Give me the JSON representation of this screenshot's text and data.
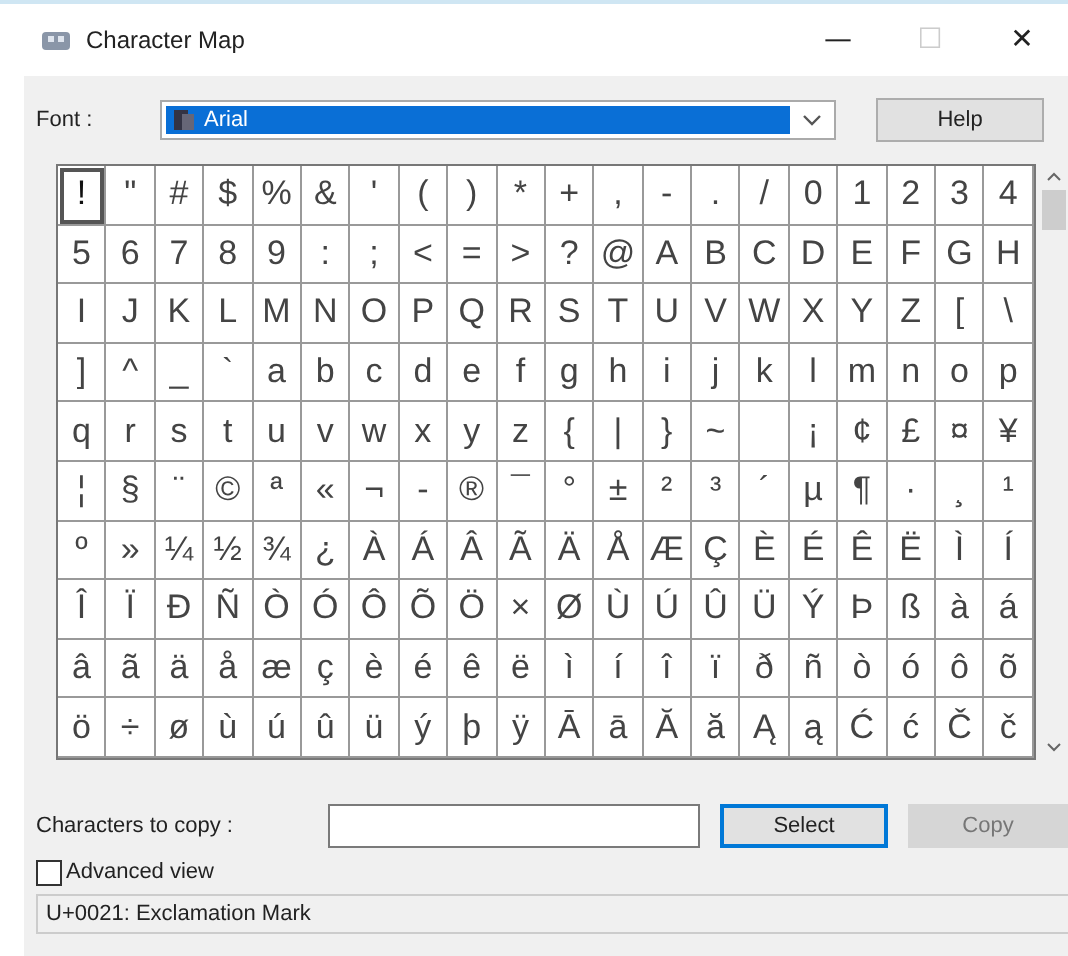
{
  "window": {
    "title": "Character Map",
    "controls": [
      "—",
      "☐",
      "✕"
    ]
  },
  "font": {
    "label": "Font :",
    "value": "Arial",
    "selected": true
  },
  "help_button": "Help",
  "grid": [
    [
      {
        "char": "!",
        "selected": true
      },
      {
        "char": "\"",
        "selected": false
      },
      {
        "char": "#",
        "selected": false
      },
      {
        "char": "$",
        "selected": false
      },
      {
        "char": "%",
        "selected": false
      },
      {
        "char": "&",
        "selected": false
      },
      {
        "char": "'",
        "selected": false
      },
      {
        "char": "(",
        "selected": false
      },
      {
        "char": ")",
        "selected": false
      },
      {
        "char": "*",
        "selected": false
      },
      {
        "char": "+",
        "selected": false
      },
      {
        "char": ",",
        "selected": false
      },
      {
        "char": "-",
        "selected": false
      },
      {
        "char": ".",
        "selected": false
      },
      {
        "char": "/",
        "selected": false
      },
      {
        "char": "0",
        "selected": false
      },
      {
        "char": "1",
        "selected": false
      },
      {
        "char": "2",
        "selected": false
      },
      {
        "char": "3",
        "selected": false
      },
      {
        "char": "4",
        "selected": false
      }
    ],
    [
      {
        "char": "5",
        "selected": false
      },
      {
        "char": "6",
        "selected": false
      },
      {
        "char": "7",
        "selected": false
      },
      {
        "char": "8",
        "selected": false
      },
      {
        "char": "9",
        "selected": false
      },
      {
        "char": ":",
        "selected": false
      },
      {
        "char": ";",
        "selected": false
      },
      {
        "char": "<",
        "selected": false
      },
      {
        "char": "=",
        "selected": false
      },
      {
        "char": ">",
        "selected": false
      },
      {
        "char": "?",
        "selected": false
      },
      {
        "char": "@",
        "selected": false
      },
      {
        "char": "A",
        "selected": false
      },
      {
        "char": "B",
        "selected": false
      },
      {
        "char": "C",
        "selected": false
      },
      {
        "char": "D",
        "selected": false
      },
      {
        "char": "E",
        "selected": false
      },
      {
        "char": "F",
        "selected": false
      },
      {
        "char": "G",
        "selected": false
      },
      {
        "char": "H",
        "selected": false
      }
    ],
    [
      {
        "char": "I",
        "selected": false
      },
      {
        "char": "J",
        "selected": false
      },
      {
        "char": "K",
        "selected": false
      },
      {
        "char": "L",
        "selected": false
      },
      {
        "char": "M",
        "selected": false
      },
      {
        "char": "N",
        "selected": false
      },
      {
        "char": "O",
        "selected": false
      },
      {
        "char": "P",
        "selected": false
      },
      {
        "char": "Q",
        "selected": false
      },
      {
        "char": "R",
        "selected": false
      },
      {
        "char": "S",
        "selected": false
      },
      {
        "char": "T",
        "selected": false
      },
      {
        "char": "U",
        "selected": false
      },
      {
        "char": "V",
        "selected": false
      },
      {
        "char": "W",
        "selected": false
      },
      {
        "char": "X",
        "selected": false
      },
      {
        "char": "Y",
        "selected": false
      },
      {
        "char": "Z",
        "selected": false
      },
      {
        "char": "[",
        "selected": false
      },
      {
        "char": "\\",
        "selected": false
      }
    ],
    [
      {
        "char": "]",
        "selected": false
      },
      {
        "char": "^",
        "selected": false
      },
      {
        "char": "_",
        "selected": false
      },
      {
        "char": "`",
        "selected": false
      },
      {
        "char": "a",
        "selected": false
      },
      {
        "char": "b",
        "selected": false
      },
      {
        "char": "c",
        "selected": false
      },
      {
        "char": "d",
        "selected": false
      },
      {
        "char": "e",
        "selected": false
      },
      {
        "char": "f",
        "selected": false
      },
      {
        "char": "g",
        "selected": false
      },
      {
        "char": "h",
        "selected": false
      },
      {
        "char": "i",
        "selected": false
      },
      {
        "char": "j",
        "selected": false
      },
      {
        "char": "k",
        "selected": false
      },
      {
        "char": "l",
        "selected": false
      },
      {
        "char": "m",
        "selected": false
      },
      {
        "char": "n",
        "selected": false
      },
      {
        "char": "o",
        "selected": false
      },
      {
        "char": "p",
        "selected": false
      }
    ],
    [
      {
        "char": "q",
        "selected": false
      },
      {
        "char": "r",
        "selected": false
      },
      {
        "char": "s",
        "selected": false
      },
      {
        "char": "t",
        "selected": false
      },
      {
        "char": "u",
        "selected": false
      },
      {
        "char": "v",
        "selected": false
      },
      {
        "char": "w",
        "selected": false
      },
      {
        "char": "x",
        "selected": false
      },
      {
        "char": "y",
        "selected": false
      },
      {
        "char": "z",
        "selected": false
      },
      {
        "char": "{",
        "selected": false
      },
      {
        "char": "|",
        "selected": false
      },
      {
        "char": "}",
        "selected": false
      },
      {
        "char": "~",
        "selected": false
      },
      {
        "selected": false
      },
      {
        "char": "¡",
        "selected": false
      },
      {
        "char": "¢",
        "selected": false
      },
      {
        "char": "£",
        "selected": false
      },
      {
        "char": "¤",
        "selected": false
      },
      {
        "char": "¥",
        "selected": false
      }
    ],
    [
      {
        "char": "¦",
        "selected": false
      },
      {
        "char": "§",
        "selected": false
      },
      {
        "char": "¨",
        "selected": false
      },
      {
        "char": "©",
        "selected": false
      },
      {
        "char": "ª",
        "selected": false
      },
      {
        "char": "«",
        "selected": false
      },
      {
        "char": "¬",
        "selected": false
      },
      {
        "char": "-",
        "selected": false
      },
      {
        "char": "®",
        "selected": false
      },
      {
        "char": "¯",
        "selected": false
      },
      {
        "char": "°",
        "selected": false
      },
      {
        "char": "±",
        "selected": false
      },
      {
        "char": "²",
        "selected": false
      },
      {
        "char": "³",
        "selected": false
      },
      {
        "char": "´",
        "selected": false
      },
      {
        "char": "µ",
        "selected": false
      },
      {
        "char": "¶",
        "selected": false
      },
      {
        "char": "·",
        "selected": false
      },
      {
        "char": "¸",
        "selected": false
      },
      {
        "char": "¹",
        "selected": false
      }
    ],
    [
      {
        "char": "º",
        "selected": false
      },
      {
        "char": "»",
        "selected": false
      },
      {
        "char": "¼",
        "selected": false
      },
      {
        "char": "½",
        "selected": false
      },
      {
        "char": "¾",
        "selected": false
      },
      {
        "char": "¿",
        "selected": false
      },
      {
        "char": "À",
        "selected": false
      },
      {
        "char": "Á",
        "selected": false
      },
      {
        "char": "Â",
        "selected": false
      },
      {
        "char": "Ã",
        "selected": false
      },
      {
        "char": "Ä",
        "selected": false
      },
      {
        "char": "Å",
        "selected": false
      },
      {
        "char": "Æ",
        "selected": false
      },
      {
        "char": "Ç",
        "selected": false
      },
      {
        "char": "È",
        "selected": false
      },
      {
        "char": "É",
        "selected": false
      },
      {
        "char": "Ê",
        "selected": false
      },
      {
        "char": "Ë",
        "selected": false
      },
      {
        "char": "Ì",
        "selected": false
      },
      {
        "char": "Í",
        "selected": false
      }
    ],
    [
      {
        "char": "Î",
        "selected": false
      },
      {
        "char": "Ï",
        "selected": false
      },
      {
        "char": "Ð",
        "selected": false
      },
      {
        "char": "Ñ",
        "selected": false
      },
      {
        "char": "Ò",
        "selected": false
      },
      {
        "char": "Ó",
        "selected": false
      },
      {
        "char": "Ô",
        "selected": false
      },
      {
        "char": "Õ",
        "selected": false
      },
      {
        "char": "Ö",
        "selected": false
      },
      {
        "char": "×",
        "selected": false
      },
      {
        "char": "Ø",
        "selected": false
      },
      {
        "char": "Ù",
        "selected": false
      },
      {
        "char": "Ú",
        "selected": false
      },
      {
        "char": "Û",
        "selected": false
      },
      {
        "char": "Ü",
        "selected": false
      },
      {
        "char": "Ý",
        "selected": false
      },
      {
        "char": "Þ",
        "selected": false
      },
      {
        "char": "ß",
        "selected": false
      },
      {
        "char": "à",
        "selected": false
      },
      {
        "char": "á",
        "selected": false
      }
    ],
    [
      {
        "char": "â",
        "selected": false
      },
      {
        "char": "ã",
        "selected": false
      },
      {
        "char": "ä",
        "selected": false
      },
      {
        "char": "å",
        "selected": false
      },
      {
        "char": "æ",
        "selected": false
      },
      {
        "char": "ç",
        "selected": false
      },
      {
        "char": "è",
        "selected": false
      },
      {
        "char": "é",
        "selected": false
      },
      {
        "char": "ê",
        "selected": false
      },
      {
        "char": "ë",
        "selected": false
      },
      {
        "char": "ì",
        "selected": false
      },
      {
        "char": "í",
        "selected": false
      },
      {
        "char": "î",
        "selected": false
      },
      {
        "char": "ï",
        "selected": false
      },
      {
        "char": "ð",
        "selected": false
      },
      {
        "char": "ñ",
        "selected": false
      },
      {
        "char": "ò",
        "selected": false
      },
      {
        "char": "ó",
        "selected": false
      },
      {
        "char": "ô",
        "selected": false
      },
      {
        "char": "õ",
        "selected": false
      }
    ],
    [
      {
        "char": "ö",
        "selected": false
      },
      {
        "char": "÷",
        "selected": false
      },
      {
        "char": "ø",
        "selected": false
      },
      {
        "char": "ù",
        "selected": false
      },
      {
        "char": "ú",
        "selected": false
      },
      {
        "char": "û",
        "selected": false
      },
      {
        "char": "ü",
        "selected": false
      },
      {
        "char": "ý",
        "selected": false
      },
      {
        "char": "þ",
        "selected": false
      },
      {
        "char": "ÿ",
        "selected": false
      },
      {
        "char": "Ā",
        "selected": false
      },
      {
        "char": "ā",
        "selected": false
      },
      {
        "char": "Ă",
        "selected": false
      },
      {
        "char": "ă",
        "selected": false
      },
      {
        "char": "Ą",
        "selected": false
      },
      {
        "char": "ą",
        "selected": false
      },
      {
        "char": "Ć",
        "selected": false
      },
      {
        "char": "ć",
        "selected": false
      },
      {
        "char": "Č",
        "selected": false
      },
      {
        "char": "č",
        "selected": false
      }
    ]
  ],
  "copy": {
    "label": "Characters to copy :",
    "select_button": "Select",
    "copy_button": {
      "label": "Copy",
      "disabled": true
    }
  },
  "advanced_view": {
    "label": "Advanced view",
    "checked": false
  },
  "status_bar": "U+0021: Exclamation Mark"
}
